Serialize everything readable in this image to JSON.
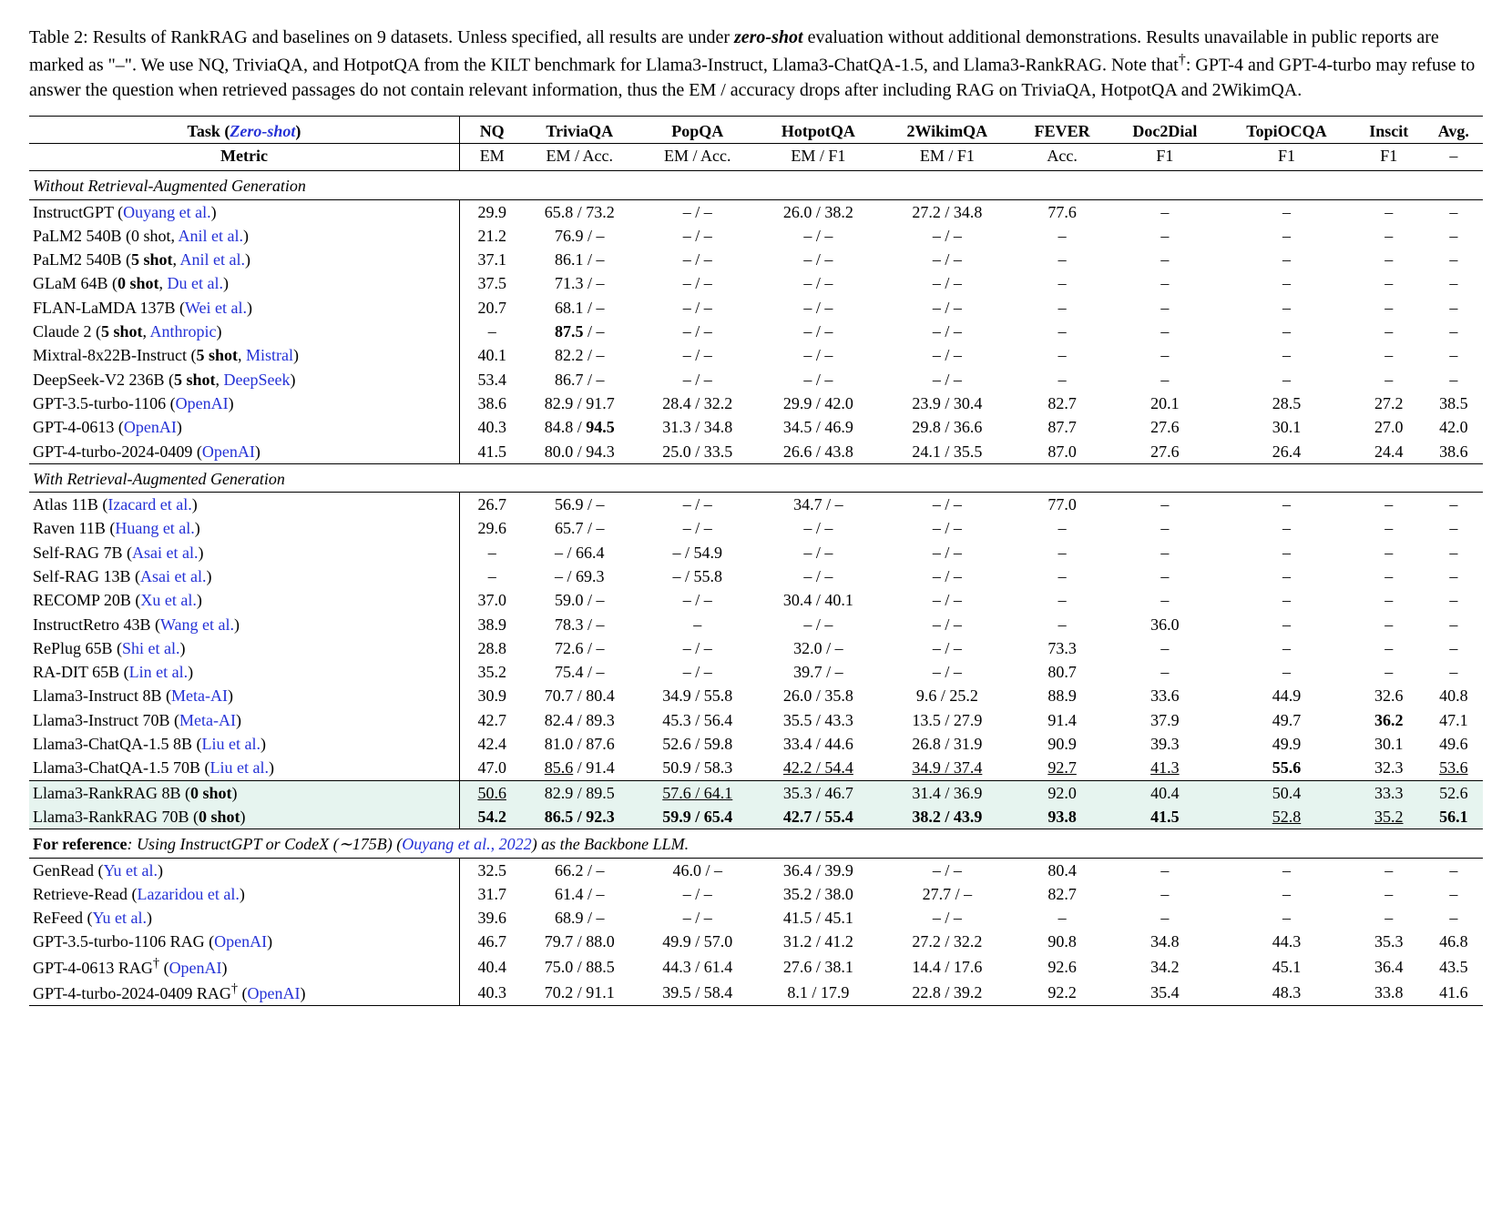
{
  "caption": {
    "prefix": "Table 2: ",
    "body_a": "Results of RankRAG and baselines on 9 datasets. Unless specified, all results are under ",
    "zeroshot": "zero-shot",
    "body_b": " evaluation without additional demonstrations. Results unavailable in public reports are marked as \"–\". We use NQ, TriviaQA, and HotpotQA from the KILT benchmark for Llama3-Instruct, Llama3-ChatQA-1.5, and Llama3-RankRAG. Note that",
    "dagger": "†",
    "body_c": ": GPT-4 and GPT-4-turbo may refuse to answer the question when retrieved passages do not contain relevant information, thus the EM / accuracy drops after including RAG on TriviaQA, HotpotQA and 2WikimQA."
  },
  "header": {
    "task_label": "Task",
    "zero_shot": "Zero-shot",
    "cols": [
      "NQ",
      "TriviaQA",
      "PopQA",
      "HotpotQA",
      "2WikimQA",
      "FEVER",
      "Doc2Dial",
      "TopiOCQA",
      "Inscit",
      "Avg."
    ],
    "metric_label": "Metric",
    "metrics": [
      "EM",
      "EM / Acc.",
      "EM / Acc.",
      "EM / F1",
      "EM / F1",
      "Acc.",
      "F1",
      "F1",
      "F1",
      "–"
    ]
  },
  "sections": {
    "without": "Without Retrieval-Augmented Generation",
    "with": "With Retrieval-Augmented Generation",
    "ref_a": "For reference",
    "ref_b": ": Using InstructGPT or CodeX (",
    "ref_c": "∼175B",
    "ref_d": ") (",
    "ref_cite": "Ouyang et al., 2022",
    "ref_e": ") as the Backbone LLM."
  },
  "rows": {
    "no_rag": [
      {
        "name": "InstructGPT",
        "cite": "Ouyang et al.",
        "v": [
          "29.9",
          "65.8 / 73.2",
          "– / –",
          "26.0 / 38.2",
          "27.2 / 34.8",
          "77.6",
          "–",
          "–",
          "–",
          "–"
        ]
      },
      {
        "name": "PaLM2 540B",
        "note": "0 shot",
        "cite": "Anil et al.",
        "v": [
          "21.2",
          "76.9 / –",
          "– / –",
          "– / –",
          "– / –",
          "–",
          "–",
          "–",
          "–",
          "–"
        ]
      },
      {
        "name": "PaLM2 540B",
        "note": "5 shot",
        "note_bold": true,
        "cite": "Anil et al.",
        "v": [
          "37.1",
          "86.1 / –",
          "– / –",
          "– / –",
          "– / –",
          "–",
          "–",
          "–",
          "–",
          "–"
        ]
      },
      {
        "name": "GLaM 64B",
        "note": "0 shot",
        "note_bold": true,
        "cite": "Du et al.",
        "v": [
          "37.5",
          "71.3 / –",
          "– / –",
          "– / –",
          "– / –",
          "–",
          "–",
          "–",
          "–",
          "–"
        ]
      },
      {
        "name": "FLAN-LaMDA 137B",
        "cite": "Wei et al.",
        "v": [
          "20.7",
          "68.1 / –",
          "– / –",
          "– / –",
          "– / –",
          "–",
          "–",
          "–",
          "–",
          "–"
        ]
      },
      {
        "name": "Claude 2",
        "note": "5 shot",
        "note_bold": true,
        "cite": "Anthropic",
        "v": [
          "–",
          "",
          "– / –",
          "– / –",
          "– / –",
          "–",
          "–",
          "–",
          "–",
          "–"
        ],
        "triviaqa_bold": "87.5",
        "triviaqa_rest": " / –"
      },
      {
        "name": "Mixtral-8x22B-Instruct",
        "note": "5 shot",
        "note_bold": true,
        "cite": "Mistral",
        "v": [
          "40.1",
          "82.2 / –",
          "– / –",
          "– / –",
          "– / –",
          "–",
          "–",
          "–",
          "–",
          "–"
        ]
      },
      {
        "name": "DeepSeek-V2 236B",
        "note": "5 shot",
        "note_bold": true,
        "cite": "DeepSeek",
        "v": [
          "53.4",
          "86.7 / –",
          "– / –",
          "– / –",
          "– / –",
          "–",
          "–",
          "–",
          "–",
          "–"
        ]
      },
      {
        "name": "GPT-3.5-turbo-1106",
        "cite": "OpenAI",
        "v": [
          "38.6",
          "82.9 / 91.7",
          "28.4 / 32.2",
          "29.9 / 42.0",
          "23.9 / 30.4",
          "82.7",
          "20.1",
          "28.5",
          "27.2",
          "38.5"
        ]
      },
      {
        "name": "GPT-4-0613",
        "cite": "OpenAI",
        "v": [
          "40.3",
          "",
          "31.3 / 34.8",
          "34.5 / 46.9",
          "29.8 / 36.6",
          "87.7",
          "27.6",
          "30.1",
          "27.0",
          "42.0"
        ],
        "triviaqa_plain": "84.8 / ",
        "triviaqa_bold2": "94.5"
      },
      {
        "name": "GPT-4-turbo-2024-0409",
        "cite": "OpenAI",
        "v": [
          "41.5",
          "80.0 / 94.3",
          "25.0 / 33.5",
          "26.6 / 43.8",
          "24.1 / 35.5",
          "87.0",
          "27.6",
          "26.4",
          "24.4",
          "38.6"
        ]
      }
    ],
    "with_rag": [
      {
        "name": "Atlas 11B",
        "cite": "Izacard et al.",
        "v": [
          "26.7",
          "56.9 / –",
          "– / –",
          "34.7 / –",
          "– / –",
          "77.0",
          "–",
          "–",
          "–",
          "–"
        ]
      },
      {
        "name": "Raven 11B",
        "cite": "Huang et al.",
        "v": [
          "29.6",
          "65.7 / –",
          "– / –",
          "– / –",
          "– / –",
          "–",
          "–",
          "–",
          "–",
          "–"
        ]
      },
      {
        "name": "Self-RAG 7B",
        "cite": "Asai et al.",
        "v": [
          "–",
          "– / 66.4",
          "– / 54.9",
          "– / –",
          "– / –",
          "–",
          "–",
          "–",
          "–",
          "–"
        ]
      },
      {
        "name": "Self-RAG 13B",
        "cite": "Asai et al.",
        "v": [
          "–",
          "– / 69.3",
          "– / 55.8",
          "– / –",
          "– / –",
          "–",
          "–",
          "–",
          "–",
          "–"
        ]
      },
      {
        "name": "RECOMP 20B",
        "cite": "Xu et al.",
        "v": [
          "37.0",
          "59.0 / –",
          "– / –",
          "30.4 / 40.1",
          "– / –",
          "–",
          "–",
          "–",
          "–",
          "–"
        ]
      },
      {
        "name": "InstructRetro 43B",
        "cite": "Wang et al.",
        "v": [
          "38.9",
          "78.3 / –",
          "–",
          "– / –",
          "– / –",
          "–",
          "36.0",
          "–",
          "–",
          "–"
        ]
      },
      {
        "name": "RePlug 65B",
        "cite": "Shi et al.",
        "v": [
          "28.8",
          "72.6 / –",
          "– / –",
          "32.0 / –",
          "– / –",
          "73.3",
          "–",
          "–",
          "–",
          "–"
        ]
      },
      {
        "name": "RA-DIT 65B",
        "cite": "Lin et al.",
        "v": [
          "35.2",
          "75.4 / –",
          "– / –",
          "39.7 / –",
          "– / –",
          "80.7",
          "–",
          "–",
          "–",
          "–"
        ]
      },
      {
        "name": "Llama3-Instruct 8B",
        "cite": "Meta-AI",
        "v": [
          "30.9",
          "70.7 / 80.4",
          "34.9 / 55.8",
          "26.0 / 35.8",
          "9.6 / 25.2",
          "88.9",
          "33.6",
          "44.9",
          "32.6",
          "40.8"
        ]
      },
      {
        "name": "Llama3-Instruct 70B",
        "cite": "Meta-AI",
        "v": [
          "42.7",
          "82.4 / 89.3",
          "45.3 / 56.4",
          "35.5 / 43.3",
          "13.5 / 27.9",
          "91.4",
          "37.9",
          "49.7",
          "",
          "47.1"
        ],
        "inscit_bold": "36.2"
      },
      {
        "name": "Llama3-ChatQA-1.5 8B",
        "cite": "Liu et al.",
        "v": [
          "42.4",
          "81.0 / 87.6",
          "52.6 / 59.8",
          "33.4 / 44.6",
          "26.8 / 31.9",
          "90.9",
          "39.3",
          "49.9",
          "30.1",
          "49.6"
        ]
      },
      {
        "name": "Llama3-ChatQA-1.5 70B",
        "cite": "Liu et al.",
        "v": [
          "47.0",
          "",
          "50.9 / 58.3",
          "",
          "",
          "",
          "",
          "",
          "32.3",
          ""
        ],
        "triviaqa_ul": "85.6",
        "triviaqa_rest2": " / 91.4",
        "hotpot_ul": "42.2 / 54.4",
        "wikim_ul": "34.9 / 37.4",
        "fever_ul": "92.7",
        "doc2_ul": "41.3",
        "topi_bold": "55.6",
        "avg_ul": "53.6"
      }
    ],
    "rankrag": [
      {
        "name": "Llama3-RankRAG 8B",
        "note": "0 shot",
        "note_bold": true,
        "v": [
          "",
          "82.9 / 89.5",
          "",
          "35.3 / 46.7",
          "31.4 / 36.9",
          "92.0",
          "40.4",
          "50.4",
          "33.3",
          "52.6"
        ],
        "nq_ul": "50.6",
        "pop_ul": "57.6 / 64.1"
      },
      {
        "name": "Llama3-RankRAG 70B",
        "note": "0 shot",
        "note_bold": true,
        "v": [
          "",
          "",
          "",
          "",
          "",
          "",
          "",
          "",
          "",
          ""
        ],
        "nq_bold": "54.2",
        "trivia_bold": "86.5 / 92.3",
        "pop_bold": "59.9 / 65.4",
        "hot_bold": "42.7 / 55.4",
        "wik_bold": "38.2 / 43.9",
        "fev_bold": "93.8",
        "doc_bold": "41.5",
        "top_ul": "52.8",
        "ins_ul": "35.2",
        "avg_bold": "56.1"
      }
    ],
    "ref": [
      {
        "name": "GenRead",
        "cite": "Yu et al.",
        "v": [
          "32.5",
          "66.2 / –",
          "46.0 / –",
          "36.4 / 39.9",
          "– / –",
          "80.4",
          "–",
          "–",
          "–",
          "–"
        ]
      },
      {
        "name": "Retrieve-Read",
        "cite": "Lazaridou et al.",
        "v": [
          "31.7",
          "61.4 / –",
          "– / –",
          "35.2 / 38.0",
          "27.7 / –",
          "82.7",
          "–",
          "–",
          "–",
          "–"
        ]
      },
      {
        "name": "ReFeed",
        "cite": "Yu et al.",
        "v": [
          "39.6",
          "68.9 / –",
          "– / –",
          "41.5 / 45.1",
          "– / –",
          "–",
          "–",
          "–",
          "–",
          "–"
        ]
      },
      {
        "name": "GPT-3.5-turbo-1106 RAG",
        "cite": "OpenAI",
        "v": [
          "46.7",
          "79.7 / 88.0",
          "49.9 / 57.0",
          "31.2 / 41.2",
          "27.2 / 32.2",
          "90.8",
          "34.8",
          "44.3",
          "35.3",
          "46.8"
        ]
      },
      {
        "name": "GPT-4-0613 RAG",
        "dagger": true,
        "cite": "OpenAI",
        "v": [
          "40.4",
          "75.0 / 88.5",
          "44.3 / 61.4",
          "27.6 / 38.1",
          "14.4 / 17.6",
          "92.6",
          "34.2",
          "45.1",
          "36.4",
          "43.5"
        ]
      },
      {
        "name": "GPT-4-turbo-2024-0409 RAG",
        "dagger": true,
        "cite": "OpenAI",
        "v": [
          "40.3",
          "70.2 / 91.1",
          "39.5 / 58.4",
          "8.1 / 17.9",
          "22.8 / 39.2",
          "92.2",
          "35.4",
          "48.3",
          "33.8",
          "41.6"
        ]
      }
    ]
  }
}
